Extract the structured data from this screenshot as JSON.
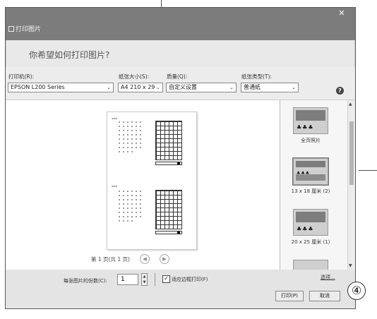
{
  "window": {
    "title": "打印图片",
    "close_icon": "close-icon"
  },
  "header": {
    "question": "你希望如何打印图片?"
  },
  "fields": {
    "printer": {
      "label": "打印机(R):",
      "value": "EPSON L200 Series"
    },
    "paper_size": {
      "label": "纸张大小(S):",
      "value": "A4 210 x 29"
    },
    "quality": {
      "label": "质量(Q):",
      "value": "自定义设置"
    },
    "paper_type": {
      "label": "纸张类型(T):",
      "value": "普通纸"
    },
    "help_label": "?"
  },
  "preview": {
    "pager_text": "第 1 页(共 1 页)"
  },
  "layouts": [
    {
      "caption": "全页照片"
    },
    {
      "caption": "13 x 18 厘米 (2)"
    },
    {
      "caption": "20 x 25 厘米 (1)"
    }
  ],
  "footer": {
    "copies_label": "每张图片的份数(C):",
    "copies_value": "1",
    "fit_label": "适应边框打印(F)",
    "fit_checked": true,
    "options_link": "选项...",
    "print_button": "打印(P)",
    "cancel_button": "取消"
  },
  "annotation": {
    "marker": "④"
  }
}
